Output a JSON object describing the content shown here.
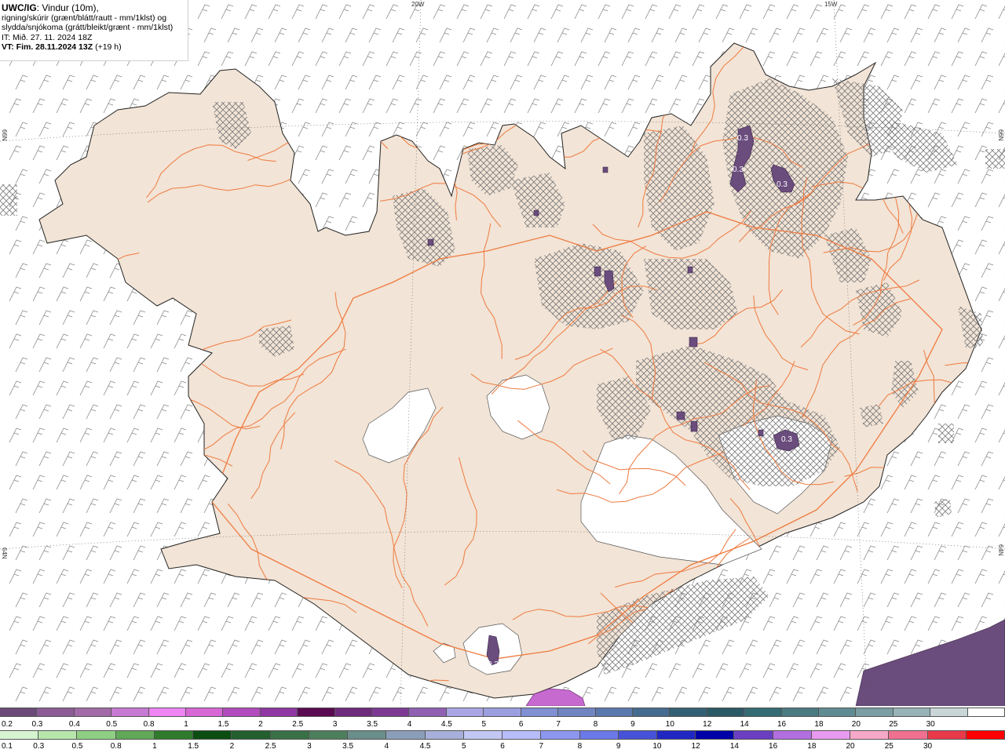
{
  "header": {
    "model": "UWC/IG",
    "line1": ": Vindur (10m),",
    "line2": "rigning/skúrir (grænt/blátt/rautt - mm/1klst) og",
    "line3": "slydda/snjókoma (grátt/bleikt/grænt - mm/1klst)",
    "line4": "IT: Mið. 27. 11. 2024 18Z",
    "vt_label": "VT: Fim. 28.11.2024 13Z",
    "vt_suffix": " (+19 h)"
  },
  "map_labels": {
    "lon_20w": "20W",
    "lon_15w": "15W",
    "lat_66n_left": "66N",
    "lat_66n_right": "66N",
    "lat_64n_left": "64N",
    "lat_64n_right": "64N",
    "contours": [
      "0.3",
      "0.3",
      "0.3",
      "0.3",
      "0.3"
    ]
  },
  "colors": {
    "land": "#f2e4d6",
    "roads": "#ef7a3f",
    "glacier": "#ffffff",
    "snow_contour": "#6a4c7d",
    "hatch": "#777777",
    "barbs": "#888888"
  },
  "legend_snow": {
    "labels": [
      "0.2",
      "0.3",
      "0.4",
      "0.5",
      "0.8",
      "1",
      "1.5",
      "2",
      "2.5",
      "3",
      "3.5",
      "4",
      "4.5",
      "5",
      "6",
      "7",
      "8",
      "9",
      "10",
      "12",
      "14",
      "16",
      "18",
      "20",
      "25",
      "30"
    ],
    "colors": [
      "#6b4a78",
      "#8c5c97",
      "#a36aa8",
      "#c77ad3",
      "#ef85f2",
      "#d768d6",
      "#b24bbd",
      "#8f37a2",
      "#5a0a52",
      "#6e2a7c",
      "#7d3a94",
      "#9060b3",
      "#aaa6e6",
      "#9b9fe0",
      "#8090d2",
      "#7085c2",
      "#5a78ad",
      "#466b90",
      "#336073",
      "#2b5a66",
      "#356b72",
      "#4a7b80",
      "#5f8c92",
      "#7a9ea4",
      "#97b3b8",
      "#c9d6d8",
      "#ffffff"
    ]
  },
  "legend_rain": {
    "labels": [
      "0.1",
      "0.3",
      "0.5",
      "0.8",
      "1",
      "1.5",
      "2",
      "2.5",
      "3",
      "3.5",
      "4",
      "4.5",
      "5",
      "6",
      "7",
      "8",
      "9",
      "10",
      "12",
      "14",
      "16",
      "18",
      "20",
      "25",
      "30"
    ],
    "colors": [
      "#d7f4d0",
      "#b7e6ac",
      "#8fcf84",
      "#61a858",
      "#2f7a2d",
      "#0c4d12",
      "#245f30",
      "#3a7047",
      "#4d7f5d",
      "#6a8e8a",
      "#8b9eb9",
      "#a7b0da",
      "#c2c8f3",
      "#b7bdfa",
      "#8d97ef",
      "#6b78e7",
      "#4652d8",
      "#2027c2",
      "#0000a8",
      "#6a3fc1",
      "#b26fe0",
      "#e89af0",
      "#f6a8c8",
      "#f07090",
      "#e83a4a",
      "#ff0000"
    ]
  }
}
